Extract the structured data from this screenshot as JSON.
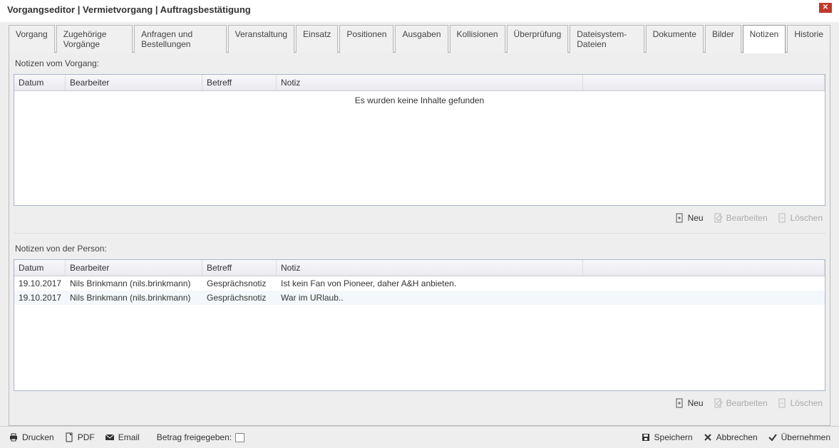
{
  "window": {
    "title": "Vorgangseditor | Vermietvorgang | Auftragsbestätigung"
  },
  "tabs": [
    "Vorgang",
    "Zugehörige Vorgänge",
    "Anfragen und Bestellungen",
    "Veranstaltung",
    "Einsatz",
    "Positionen",
    "Ausgaben",
    "Kollisionen",
    "Überprüfung",
    "Dateisystem-Dateien",
    "Dokumente",
    "Bilder",
    "Notizen",
    "Historie"
  ],
  "active_tab": "Notizen",
  "section1": {
    "label": "Notizen vom Vorgang:",
    "headers": {
      "datum": "Datum",
      "bearbeiter": "Bearbeiter",
      "betreff": "Betreff",
      "notiz": "Notiz"
    },
    "empty_text": "Es wurden keine Inhalte gefunden",
    "buttons": {
      "neu": "Neu",
      "bearbeiten": "Bearbeiten",
      "loeschen": "Löschen"
    }
  },
  "section2": {
    "label": "Notizen von der Person:",
    "headers": {
      "datum": "Datum",
      "bearbeiter": "Bearbeiter",
      "betreff": "Betreff",
      "notiz": "Notiz"
    },
    "rows": [
      {
        "datum": "19.10.2017",
        "bearbeiter": "Nils Brinkmann (nils.brinkmann)",
        "betreff": "Gesprächsnotiz",
        "notiz": "Ist kein Fan von Pioneer, daher A&H anbieten."
      },
      {
        "datum": "19.10.2017",
        "bearbeiter": "Nils Brinkmann (nils.brinkmann)",
        "betreff": "Gesprächsnotiz",
        "notiz": "War im URlaub.."
      }
    ],
    "buttons": {
      "neu": "Neu",
      "bearbeiten": "Bearbeiten",
      "loeschen": "Löschen"
    }
  },
  "footer": {
    "drucken": "Drucken",
    "pdf": "PDF",
    "email": "Email",
    "betrag": "Betrag freigegeben:",
    "speichern": "Speichern",
    "abbrechen": "Abbrechen",
    "uebernehmen": "Übernehmen"
  }
}
